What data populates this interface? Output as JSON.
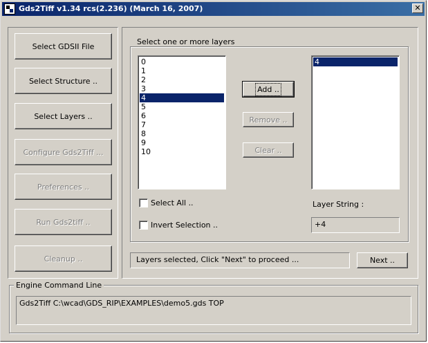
{
  "window": {
    "title": "Gds2Tiff v1.34 rcs(2.236) (March 16, 2007)",
    "close_glyph": "✕"
  },
  "left_buttons": [
    {
      "label": "Select GDSII File",
      "enabled": true
    },
    {
      "label": "Select Structure ..",
      "enabled": true
    },
    {
      "label": "Select Layers ..",
      "enabled": true
    },
    {
      "label": "Configure Gds2Tiff ...",
      "enabled": false
    },
    {
      "label": "Preferences ..",
      "enabled": false
    },
    {
      "label": "Run Gds2tiff ..",
      "enabled": false
    },
    {
      "label": "Cleanup ..",
      "enabled": false
    }
  ],
  "layers_group": {
    "label": "Select one or more layers",
    "available_layers": [
      "0",
      "1",
      "2",
      "3",
      "4",
      "5",
      "6",
      "7",
      "8",
      "9",
      "10"
    ],
    "highlighted_layer": "4",
    "selected_layers": [
      "4"
    ],
    "add_label": "Add ..",
    "remove_label": "Remove ..",
    "clear_label": "Clear ..",
    "select_all_label": "Select All ..",
    "select_all_checked": false,
    "invert_label": "Invert Selection ..",
    "invert_checked": false,
    "layer_string_label": "Layer String :",
    "layer_string_value": "+4"
  },
  "status": {
    "message": "Layers selected, Click \"Next\" to proceed ...",
    "next_label": "Next .."
  },
  "engine": {
    "label": "Engine Command Line",
    "command": "Gds2Tiff C:\\wcad\\GDS_RIP\\EXAMPLES\\demo5.gds TOP"
  }
}
